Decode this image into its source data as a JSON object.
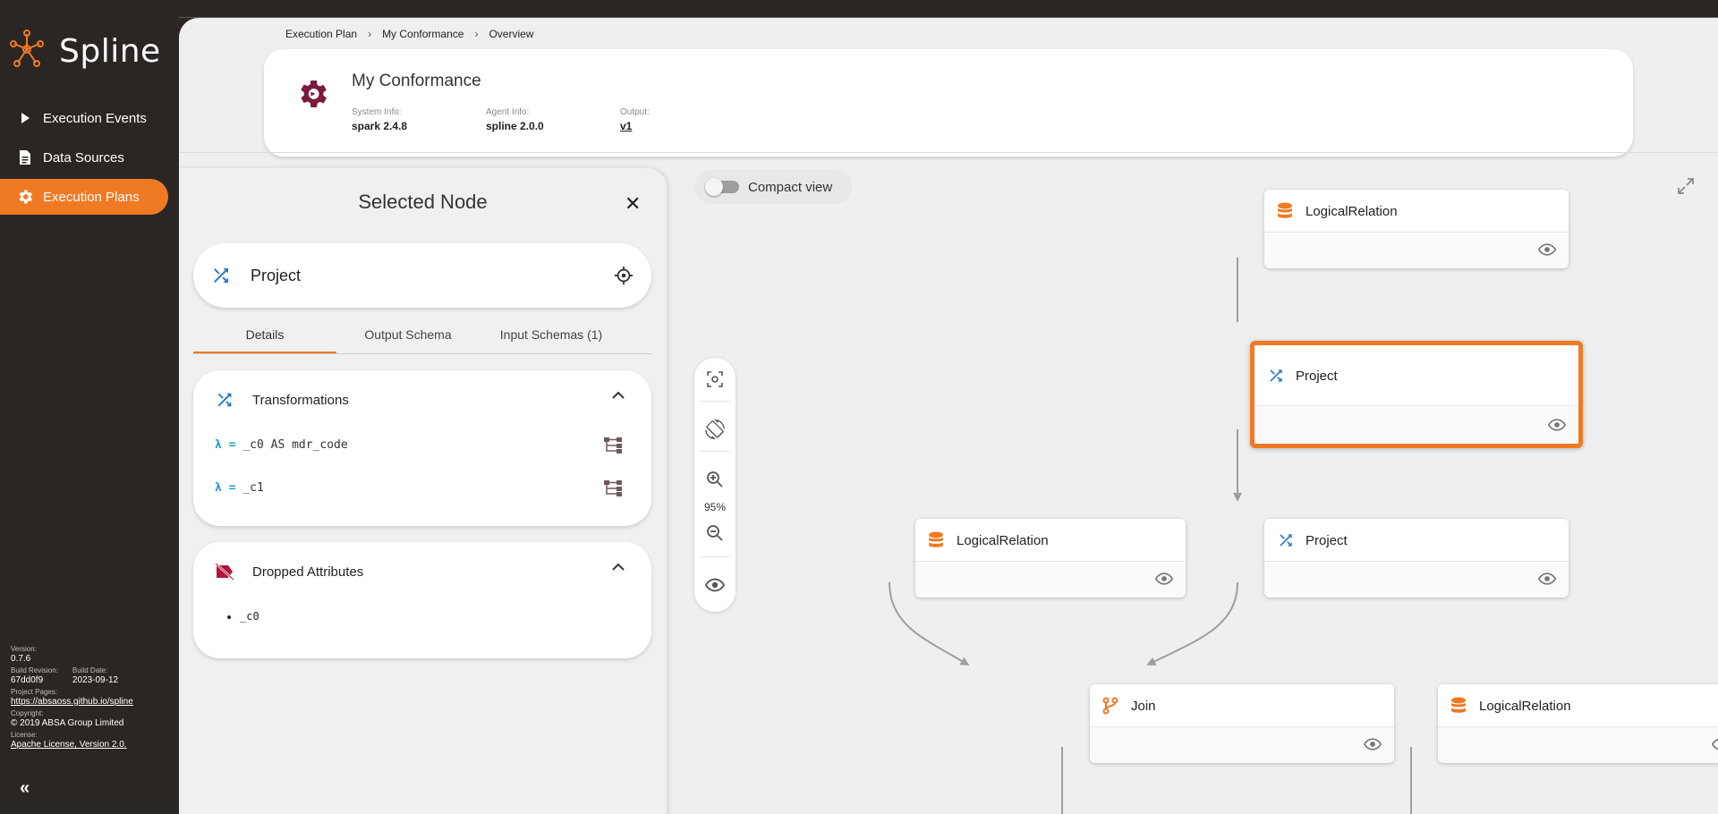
{
  "app": {
    "name": "Spline"
  },
  "sidebar": {
    "items": [
      {
        "label": "Execution Events",
        "icon": "play-icon"
      },
      {
        "label": "Data Sources",
        "icon": "document-icon"
      },
      {
        "label": "Execution Plans",
        "icon": "gear-icon",
        "active": true
      }
    ],
    "footer": {
      "version_label": "Version:",
      "version": "0.7.6",
      "build_revision_label": "Build Revision:",
      "build_revision": "67dd0f9",
      "build_date_label": "Build Date:",
      "build_date": "2023-09-12",
      "project_pages_label": "Project Pages:",
      "project_pages": "https://absaoss.github.io/spline",
      "copyright_label": "Copyright:",
      "copyright": "© 2019 ABSA Group Limited",
      "license_label": "License:",
      "license": "Apache License, Version 2.0."
    },
    "collapse_label": "«"
  },
  "breadcrumb": [
    "Execution Plan",
    "My Conformance",
    "Overview"
  ],
  "header": {
    "title": "My Conformance",
    "system_info_label": "System Info:",
    "system_info": "spark 2.4.8",
    "agent_info_label": "Agent Info:",
    "agent_info": "spline 2.0.0",
    "output_label": "Output:",
    "output": "v1"
  },
  "panel": {
    "title": "Selected Node",
    "close_label": "✕",
    "node_label": "Project",
    "tabs": [
      "Details",
      "Output Schema",
      "Input Schemas (1)"
    ],
    "active_tab": 0,
    "transformations": {
      "title": "Transformations",
      "items": [
        {
          "lambda": "λ =",
          "expr": "_c0 AS mdr_code"
        },
        {
          "lambda": "λ =",
          "expr": "_c1"
        }
      ]
    },
    "dropped": {
      "title": "Dropped Attributes",
      "items": [
        "_c0"
      ]
    }
  },
  "graph": {
    "compact_view_label": "Compact view",
    "compact_view_on": false,
    "zoom_level": "95%",
    "nodes": [
      {
        "label": "LogicalRelation",
        "type": "relation"
      },
      {
        "label": "Project",
        "type": "project",
        "selected": true
      },
      {
        "label": "LogicalRelation",
        "type": "relation"
      },
      {
        "label": "Project",
        "type": "project"
      },
      {
        "label": "Join",
        "type": "join"
      },
      {
        "label": "LogicalRelation",
        "type": "relation"
      }
    ]
  },
  "colors": {
    "accent": "#f07a24",
    "project_icon": "#2a78c4",
    "sidebar_bg": "#2b2623",
    "dropped_icon": "#b0163a",
    "gear_brand": "#7a1a3e"
  }
}
